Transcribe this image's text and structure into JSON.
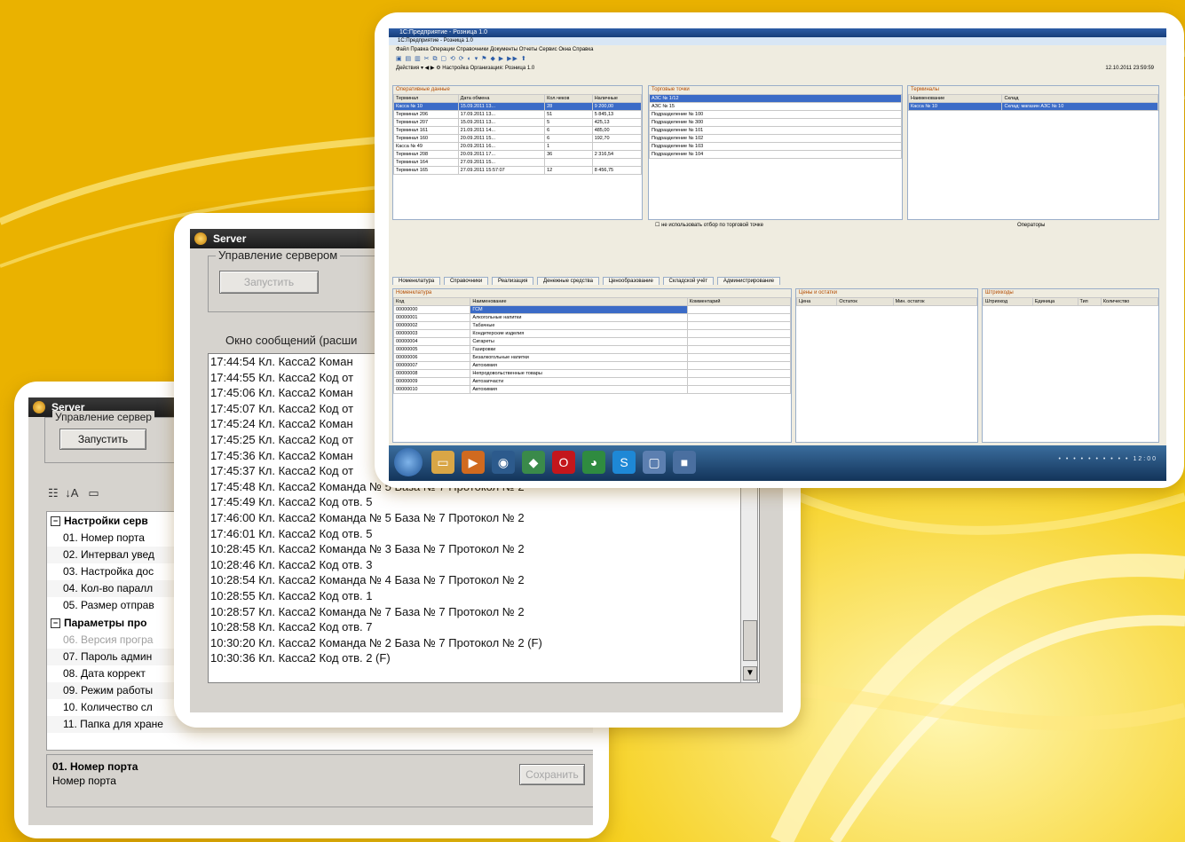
{
  "colors": {
    "background": "#f2c400",
    "accent_blue": "#3b6bc7",
    "window_gray": "#d6d3ce"
  },
  "settings_window": {
    "title": "Server",
    "group_label": "Управление сервер",
    "start_button": "Запустить",
    "sort_icon": "sort-az-icon",
    "categories": [
      {
        "label": "Настройки серв",
        "items": [
          "01. Номер порта",
          "02. Интервал увед",
          "03. Настройка дос",
          "04. Кол-во паралл",
          "05. Размер отправ"
        ]
      },
      {
        "label": "Параметры про",
        "items": [
          "06. Версия програ",
          "07. Пароль админ",
          "08. Дата коррект",
          "09. Режим работы",
          "10. Количество сл",
          "11. Папка для хране"
        ]
      }
    ],
    "desc_title": "01. Номер порта",
    "desc_text": "Номер порта",
    "save_button": "Сохранить"
  },
  "log_window": {
    "title": "Server",
    "group_label": "Управление сервером",
    "start_button": "Запустить",
    "log_label": "Окно сообщений (расши",
    "lines": [
      "17:44:54 Кл. Касса2 Коман",
      "17:44:55 Кл. Касса2 Код от",
      "17:45:06 Кл. Касса2 Коман",
      "17:45:07 Кл. Касса2 Код от",
      "17:45:24 Кл. Касса2 Коман",
      "17:45:25 Кл. Касса2 Код от",
      "17:45:36 Кл. Касса2 Коман",
      "17:45:37 Кл. Касса2 Код от",
      "17:45:48 Кл. Касса2 Команда № 5 База № 7 Протокол № 2",
      "17:45:49 Кл. Касса2 Код отв. 5",
      "17:46:00 Кл. Касса2 Команда № 5 База № 7 Протокол № 2",
      "17:46:01 Кл. Касса2 Код отв. 5",
      "10:28:45 Кл. Касса2 Команда № 3 База № 7 Протокол № 2",
      "10:28:46 Кл. Касса2 Код отв. 3",
      "10:28:54 Кл. Касса2 Команда № 4 База № 7 Протокол № 2",
      "10:28:55 Кл. Касса2 Код отв. 1",
      "10:28:57 Кл. Касса2 Команда № 7 База № 7 Протокол № 2",
      "10:28:58 Кл. Касса2 Код отв. 7",
      "10:30:20 Кл. Касса2 Команда № 2 База № 7 Протокол № 2 (F)",
      "10:30:36 Кл. Касса2 Код отв. 2 (F)"
    ]
  },
  "main_window": {
    "title_bar": "1С:Предприятие - Розница 1.0",
    "sub_title": "1С:Предприятие - Розница 1.0",
    "menu": "Файл  Правка  Операции  Справочники  Документы  Отчеты  Сервис  Окна  Справка",
    "toolbar_row": "Действия ▾  ◀ ▶  ⚙ Настройка  Организация: Розница 1.0",
    "timestamp": "12.10.2011 23:59:59",
    "panel_left_title": "Оперативные данные",
    "panel_left_headers": [
      "Терминал",
      "Дата обмена",
      "Кол.чеков",
      "Наличные"
    ],
    "panel_left_rows": [
      [
        "Касса № 10",
        "15.09.2011 13...",
        "28",
        "9 200,00"
      ],
      [
        "Терминал 206",
        "17.09.2011 13...",
        "51",
        "5 845,13"
      ],
      [
        "Терминал 207",
        "15.09.2011 13...",
        "5",
        "425,13"
      ],
      [
        "Терминал 161",
        "21.09.2011 14...",
        "6",
        "485,00"
      ],
      [
        "Терминал 160",
        "20.09.2011 15...",
        "6",
        "192,70"
      ],
      [
        "Касса № 49",
        "20.09.2011 16...",
        "1",
        ""
      ],
      [
        "Терминал 208",
        "20.09.2011 17...",
        "36",
        "2 316,54"
      ],
      [
        "Терминал 164",
        "27.09.2011 15...",
        "",
        ""
      ],
      [
        "Терминал 165",
        "27.09.2011 15:57:07",
        "12",
        "8 456,75"
      ]
    ],
    "panel_mid_title": "Торговые точки",
    "panel_mid_items": [
      "АЗС № 1/12",
      "АЗС № 15",
      "Подразделение № 100",
      "Подразделение № 300",
      "Подразделение № 101",
      "Подразделение № 102",
      "Подразделение № 103",
      "Подразделение № 104"
    ],
    "panel_right_title": "Терминалы",
    "panel_right_headers": [
      "Наименование",
      "Склад"
    ],
    "panel_right_row": [
      "Касса № 10",
      "Склад: магазин АЗС № 10"
    ],
    "operators_label": "Операторы",
    "checkbox_label": "не использовать отбор по торговой точке",
    "tabs": [
      "Номенклатура",
      "Справочники",
      "Реализация",
      "Денежные средства",
      "Ценообразование",
      "Складской учёт",
      "Администрирование"
    ],
    "nom_title": "Номенклатура",
    "nom_headers": [
      "Код",
      "Наименование",
      "Комментарий"
    ],
    "nom_rows": [
      [
        "00000000",
        "ГСМ"
      ],
      [
        "00000001",
        "Алкогольные напитки"
      ],
      [
        "00000002",
        "Табачные"
      ],
      [
        "00000003",
        "Кондитерские изделия"
      ],
      [
        "00000004",
        "Сигареты"
      ],
      [
        "00000005",
        "Газировки"
      ],
      [
        "00000006",
        "Безалкогольные напитки"
      ],
      [
        "00000007",
        "Автохимия"
      ],
      [
        "00000008",
        "Непродовольственные товары"
      ],
      [
        "00000009",
        "Автозапчасти"
      ],
      [
        "00000010",
        "Автохимия"
      ]
    ],
    "prices_title": "Цены и остатки",
    "prices_headers": [
      "Цена",
      "Остаток",
      "Мин. остаток"
    ],
    "barcodes_title": "Штрихкоды",
    "barcodes_headers": [
      "Штрихкод",
      "Единица",
      "Тип",
      "Количество"
    ],
    "tray_time": "12:00"
  }
}
